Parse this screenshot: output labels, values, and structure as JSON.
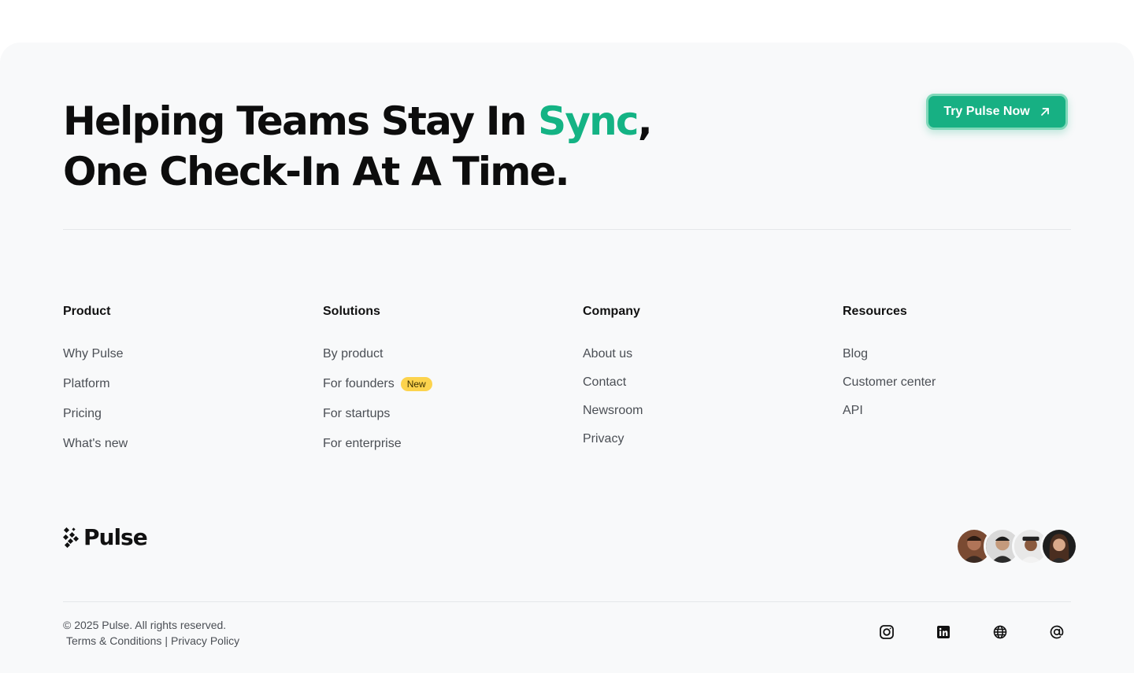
{
  "headline": {
    "line1_before": "Helping Teams Stay In ",
    "line1_accent": "Sync",
    "line1_after": ",",
    "line2": "One Check-In At A Time."
  },
  "cta": {
    "label": "Try Pulse Now",
    "icon": "arrow-up-right-icon"
  },
  "columns": [
    {
      "title": "Product",
      "links": [
        {
          "label": "Why Pulse"
        },
        {
          "label": "Platform"
        },
        {
          "label": "Pricing"
        },
        {
          "label": "What's new"
        }
      ]
    },
    {
      "title": "Solutions",
      "links": [
        {
          "label": "By product"
        },
        {
          "label": "For founders",
          "badge": "New"
        },
        {
          "label": "For startups"
        },
        {
          "label": "For enterprise"
        }
      ]
    },
    {
      "title": "Company",
      "links": [
        {
          "label": "About us"
        },
        {
          "label": "Contact"
        },
        {
          "label": "Newsroom"
        },
        {
          "label": "Privacy"
        }
      ]
    },
    {
      "title": "Resources",
      "links": [
        {
          "label": "Blog"
        },
        {
          "label": "Customer center"
        },
        {
          "label": "API"
        }
      ]
    }
  ],
  "brand": {
    "name": "Pulse",
    "icon": "pulse-logo-icon"
  },
  "avatars": [
    "avatar-1",
    "avatar-2",
    "avatar-3",
    "avatar-4"
  ],
  "legal": {
    "copyright": "© 2025 Pulse. All rights reserved.",
    "terms": "Terms & Conditions",
    "separator": "|",
    "privacy": "Privacy Policy"
  },
  "socials": [
    {
      "name": "instagram-icon"
    },
    {
      "name": "linkedin-icon"
    },
    {
      "name": "globe-icon"
    },
    {
      "name": "at-sign-icon"
    }
  ],
  "colors": {
    "accent": "#14b384",
    "badge": "#fcd34d",
    "background": "#f8f9fa"
  }
}
